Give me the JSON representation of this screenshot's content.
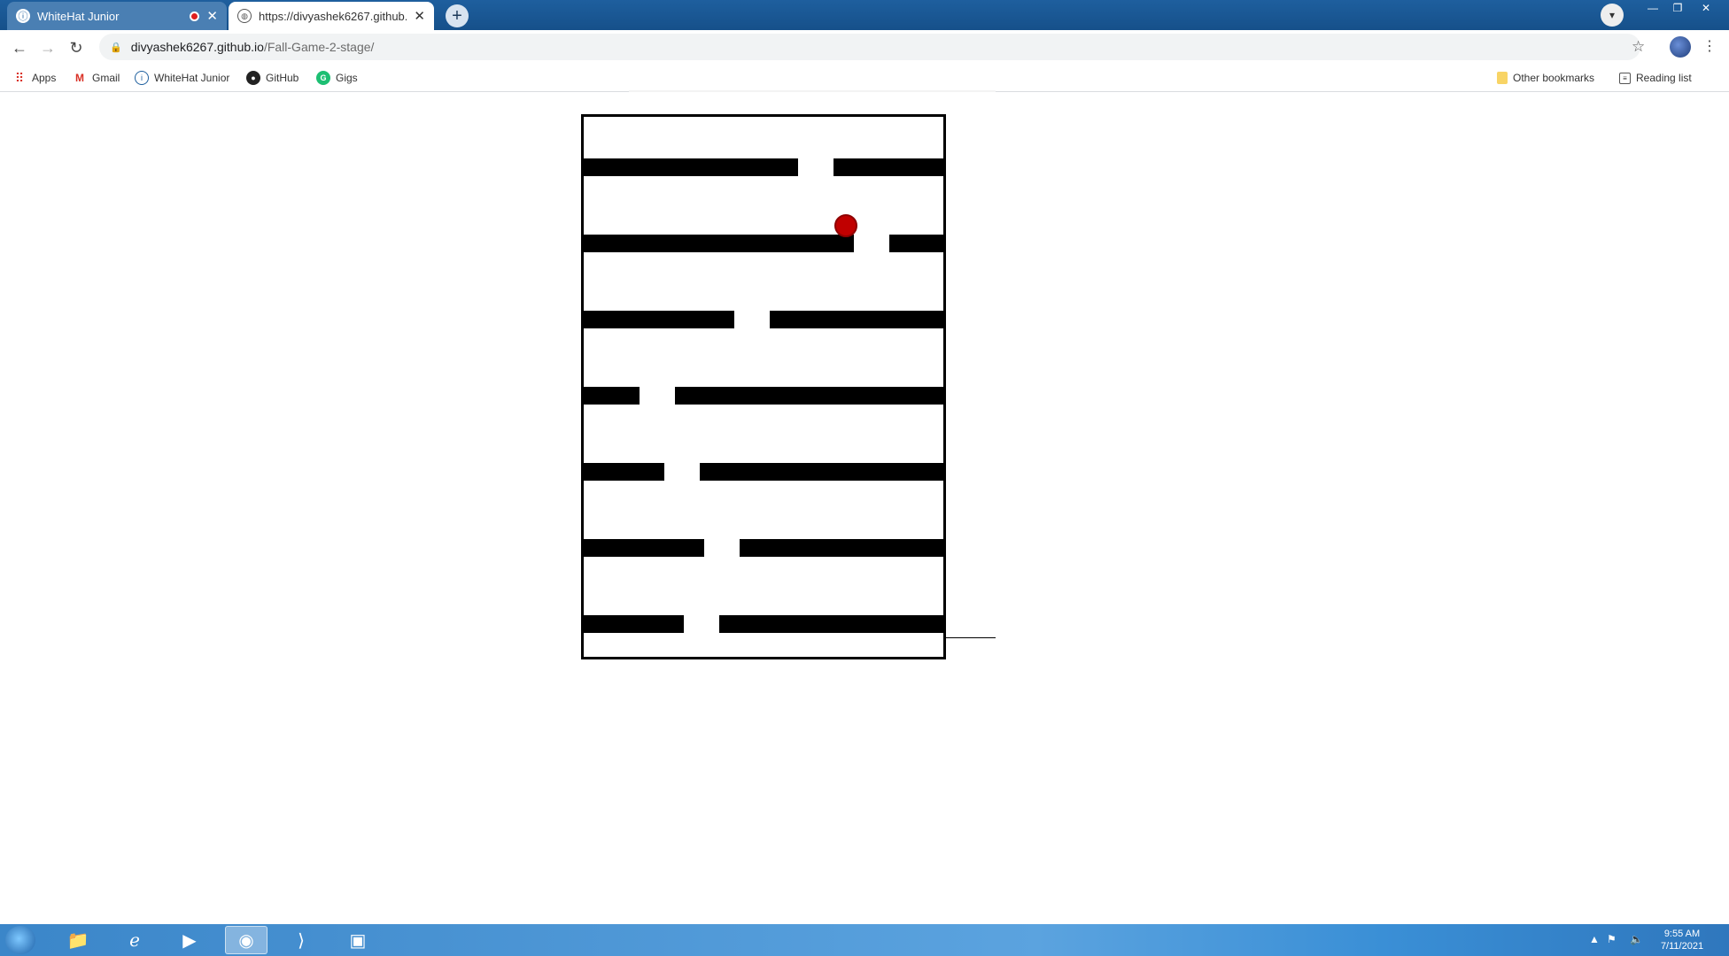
{
  "tabs": [
    {
      "title": "WhiteHat Junior",
      "favicon": "whitehat-icon",
      "recording": true
    },
    {
      "title": "https://divyashek6267.github.io/F",
      "favicon": "globe-icon"
    }
  ],
  "toolbar": {
    "url_host": "divyashek6267.github.io",
    "url_path": "/Fall-Game-2-stage/"
  },
  "bookmarks": [
    {
      "label": "Apps",
      "icon": "apps-grid-icon"
    },
    {
      "label": "Gmail",
      "icon": "gmail-icon"
    },
    {
      "label": "WhiteHat Junior",
      "icon": "whitehat-icon"
    },
    {
      "label": "GitHub",
      "icon": "github-icon"
    },
    {
      "label": "Gigs",
      "icon": "gigs-icon"
    }
  ],
  "bookmarks_right": [
    {
      "label": "Other bookmarks",
      "icon": "folder-icon"
    },
    {
      "label": "Reading list",
      "icon": "reading-list-icon"
    }
  ],
  "game": {
    "ball_color": "#c00000",
    "wall_color": "#000000"
  },
  "taskbar": {
    "time": "9:55 AM",
    "date": "7/11/2021"
  }
}
